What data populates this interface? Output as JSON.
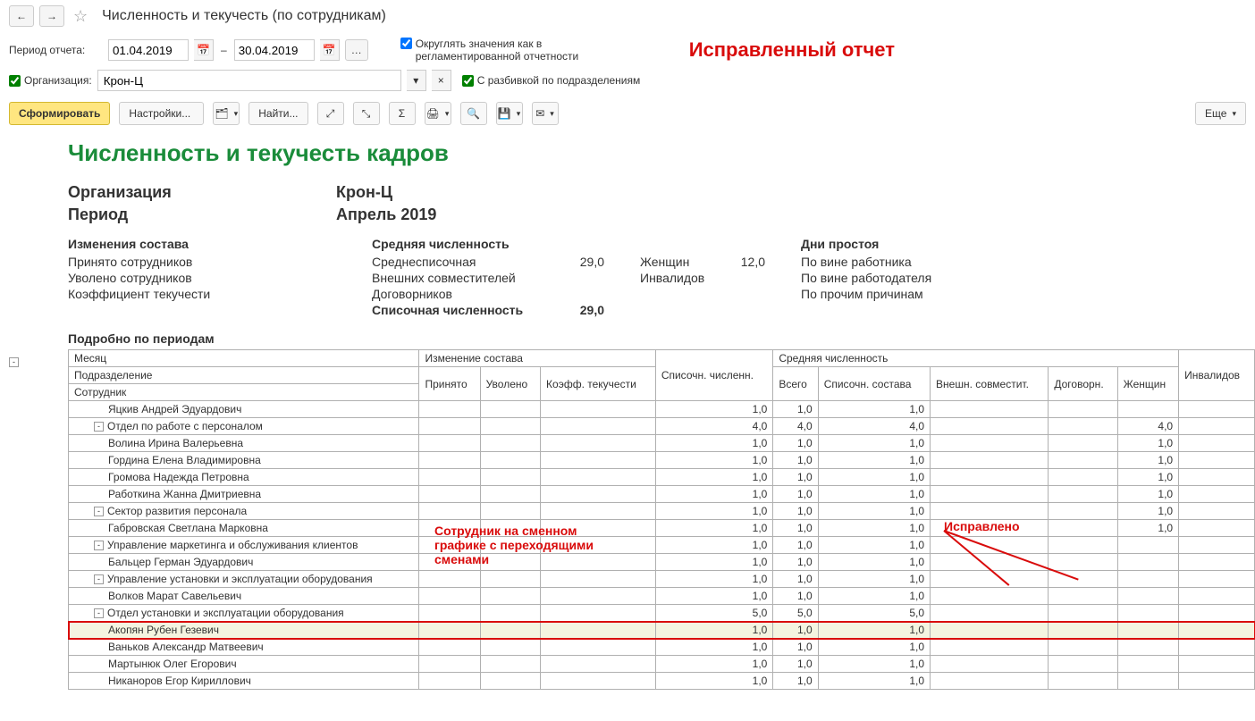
{
  "header": {
    "title": "Численность и текучесть (по сотрудникам)"
  },
  "filters": {
    "period_label": "Период отчета:",
    "date_from": "01.04.2019",
    "date_to": "30.04.2019",
    "org_label": "Организация:",
    "org_value": "Крон-Ц",
    "round_label": "Округлять значения как в регламентированной отчетности",
    "by_dept_label": "С разбивкой по подразделениям",
    "fixed_report_note": "Исправленный отчет"
  },
  "toolbar": {
    "form": "Сформировать",
    "settings": "Настройки...",
    "find": "Найти...",
    "more": "Еще"
  },
  "report": {
    "title": "Численность и текучесть кадров",
    "org_label": "Организация",
    "org_value": "Крон-Ц",
    "period_label": "Период",
    "period_value": "Апрель 2019",
    "summary": {
      "changes_head": "Изменения состава",
      "hired": "Принято сотрудников",
      "fired": "Уволено сотрудников",
      "turnover": "Коэффициент текучести",
      "avg_head": "Средняя численность",
      "avg_list": "Среднесписочная",
      "avg_list_val": "29,0",
      "external": "Внешних совместителей",
      "contract": "Договорников",
      "list_count": "Списочная численность",
      "list_count_val": "29,0",
      "women": "Женщин",
      "women_val": "12,0",
      "disabled": "Инвалидов",
      "downtime_head": "Дни простоя",
      "d_employee": "По вине работника",
      "d_employer": "По вине работодателя",
      "d_other": "По прочим причинам"
    },
    "section_periods": "Подробно по периодам",
    "columns": {
      "month": "Месяц",
      "dept": "Подразделение",
      "employee": "Сотрудник",
      "change": "Изменение состава",
      "hired": "Принято",
      "fired": "Уволено",
      "turnover": "Коэфф. текучести",
      "list": "Списочн. численн.",
      "avg": "Средняя численность",
      "total": "Всего",
      "list2": "Списочн. состава",
      "external": "Внешн. совместит.",
      "contract": "Договорн.",
      "women": "Женщин",
      "disabled": "Инвалидов"
    },
    "rows": [
      {
        "name": "Яцкив Андрей Эдуардович",
        "lvl": 2,
        "list": "1,0",
        "total": "1,0",
        "list2": "1,0"
      },
      {
        "name": "Отдел по работе с персоналом",
        "lvl": 1,
        "tree": "-",
        "list": "4,0",
        "total": "4,0",
        "list2": "4,0",
        "women": "4,0"
      },
      {
        "name": "Волина Ирина Валерьевна",
        "lvl": 2,
        "list": "1,0",
        "total": "1,0",
        "list2": "1,0",
        "women": "1,0"
      },
      {
        "name": "Гордина Елена Владимировна",
        "lvl": 2,
        "list": "1,0",
        "total": "1,0",
        "list2": "1,0",
        "women": "1,0"
      },
      {
        "name": "Громова Надежда Петровна",
        "lvl": 2,
        "list": "1,0",
        "total": "1,0",
        "list2": "1,0",
        "women": "1,0"
      },
      {
        "name": "Работкина Жанна Дмитриевна",
        "lvl": 2,
        "list": "1,0",
        "total": "1,0",
        "list2": "1,0",
        "women": "1,0"
      },
      {
        "name": "Сектор развития персонала",
        "lvl": 1,
        "tree": "-",
        "list": "1,0",
        "total": "1,0",
        "list2": "1,0",
        "women": "1,0"
      },
      {
        "name": "Габровская Светлана Марковна",
        "lvl": 2,
        "list": "1,0",
        "total": "1,0",
        "list2": "1,0",
        "women": "1,0"
      },
      {
        "name": "Управление маркетинга и обслуживания клиентов",
        "lvl": 1,
        "tree": "-",
        "list": "1,0",
        "total": "1,0",
        "list2": "1,0"
      },
      {
        "name": "Бальцер Герман Эдуардович",
        "lvl": 2,
        "list": "1,0",
        "total": "1,0",
        "list2": "1,0"
      },
      {
        "name": "Управление установки и эксплуатации оборудования",
        "lvl": 1,
        "tree": "-",
        "list": "1,0",
        "total": "1,0",
        "list2": "1,0"
      },
      {
        "name": "Волков Марат Савельевич",
        "lvl": 2,
        "list": "1,0",
        "total": "1,0",
        "list2": "1,0"
      },
      {
        "name": "Отдел установки и эксплуатации оборудования",
        "lvl": 1,
        "tree": "-",
        "list": "5,0",
        "total": "5,0",
        "list2": "5,0"
      },
      {
        "name": "Акопян Рубен Гезевич",
        "lvl": 2,
        "highlight": true,
        "list": "1,0",
        "total": "1,0",
        "list2": "1,0"
      },
      {
        "name": "Ваньков Александр Матвеевич",
        "lvl": 2,
        "list": "1,0",
        "total": "1,0",
        "list2": "1,0"
      },
      {
        "name": "Мартынюк Олег Егорович",
        "lvl": 2,
        "list": "1,0",
        "total": "1,0",
        "list2": "1,0"
      },
      {
        "name": "Никаноров Егор Кириллович",
        "lvl": 2,
        "list": "1,0",
        "total": "1,0",
        "list2": "1,0"
      }
    ]
  },
  "annotations": {
    "shift_note": "Сотрудник на сменном графике с переходящими сменами",
    "fixed": "Исправлено"
  }
}
